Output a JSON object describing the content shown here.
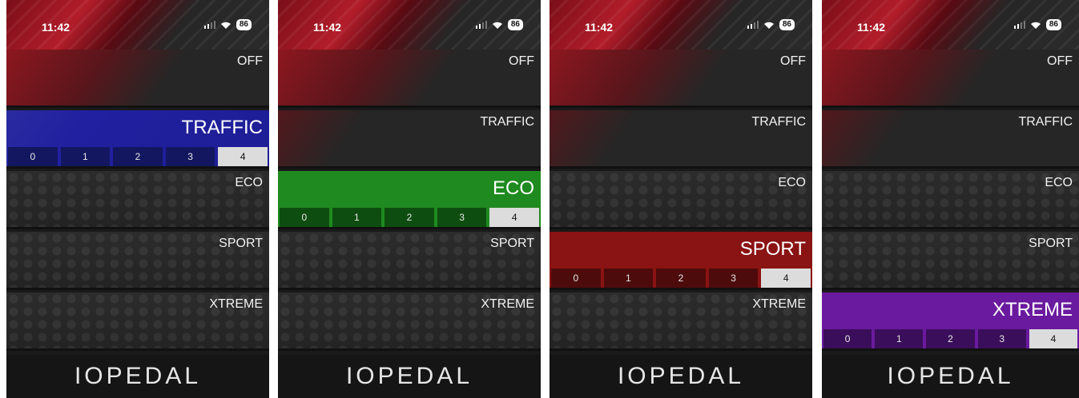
{
  "phones": [
    {
      "time": "11:42",
      "battery": "86",
      "brand": "IOPEDAL",
      "active": "TRAFFIC",
      "levels": [
        "0",
        "1",
        "2",
        "3",
        "4"
      ],
      "selected_level": "4",
      "modes": [
        "OFF",
        "TRAFFIC",
        "ECO",
        "SPORT",
        "XTREME"
      ]
    },
    {
      "time": "11:42",
      "battery": "86",
      "brand": "IOPEDAL",
      "active": "ECO",
      "levels": [
        "0",
        "1",
        "2",
        "3",
        "4"
      ],
      "selected_level": "4",
      "modes": [
        "OFF",
        "TRAFFIC",
        "ECO",
        "SPORT",
        "XTREME"
      ]
    },
    {
      "time": "11:42",
      "battery": "86",
      "brand": "IOPEDAL",
      "active": "SPORT",
      "levels": [
        "0",
        "1",
        "2",
        "3",
        "4"
      ],
      "selected_level": "4",
      "modes": [
        "OFF",
        "TRAFFIC",
        "ECO",
        "SPORT",
        "XTREME"
      ]
    },
    {
      "time": "11:42",
      "battery": "86",
      "brand": "IOPEDAL",
      "active": "XTREME",
      "levels": [
        "0",
        "1",
        "2",
        "3",
        "4"
      ],
      "selected_level": "4",
      "modes": [
        "OFF",
        "TRAFFIC",
        "ECO",
        "SPORT",
        "XTREME"
      ]
    }
  ],
  "colors": {
    "traffic": "#1e1e96",
    "eco": "#1f8a1f",
    "sport": "#8a1313",
    "xtreme": "#6a1a9e",
    "selected_level": "#dcdcdc"
  },
  "icons": {
    "signal": "signal-icon",
    "wifi": "wifi-icon",
    "battery": "battery-icon"
  }
}
